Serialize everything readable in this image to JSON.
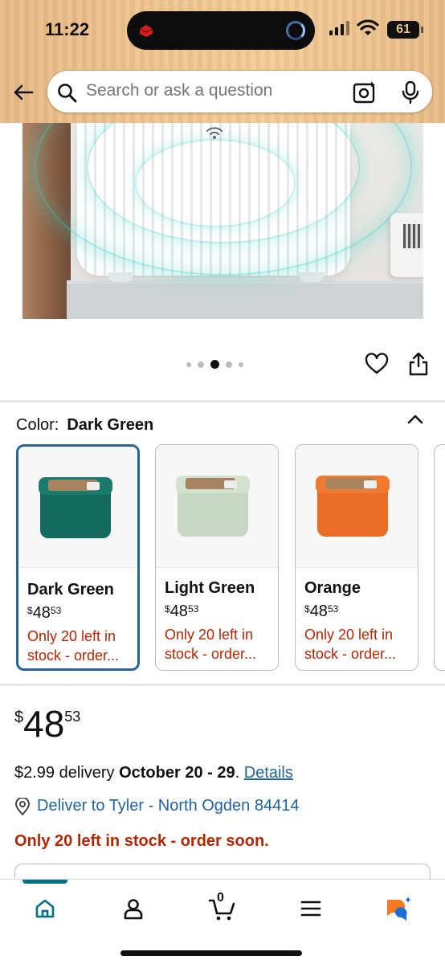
{
  "status_bar": {
    "time": "11:22",
    "battery": "61"
  },
  "search": {
    "placeholder": "Search or ask a question"
  },
  "carousel": {
    "total": 5,
    "active_index": 2
  },
  "color": {
    "label": "Color:",
    "selected": "Dark Green",
    "options": [
      {
        "name": "Dark Green",
        "price_whole": "48",
        "price_fraction": "53",
        "currency": "$",
        "stock": "Only 20 left in stock - order...",
        "body_color": "#136b5e",
        "lid_color": "#1a7a6c",
        "selected": true
      },
      {
        "name": "Light Green",
        "price_whole": "48",
        "price_fraction": "53",
        "currency": "$",
        "stock": "Only 20 left in stock - order...",
        "body_color": "#c7d8c2",
        "lid_color": "#d3e1cf",
        "selected": false
      },
      {
        "name": "Orange",
        "price_whole": "48",
        "price_fraction": "53",
        "currency": "$",
        "stock": "Only 20 left in stock - order...",
        "body_color": "#e96d24",
        "lid_color": "#f07a2f",
        "selected": false
      }
    ]
  },
  "price": {
    "currency": "$",
    "whole": "48",
    "fraction": "53"
  },
  "delivery": {
    "prefix": "$2.99 delivery ",
    "dates": "October 20 - 29",
    "suffix": ". ",
    "details_link": "Details"
  },
  "location": {
    "text": "Deliver to Tyler - North Ogden 84414"
  },
  "stock_message": "Only 20 left in stock - order soon.",
  "bottom_nav": {
    "cart_count": "0",
    "active": "home"
  },
  "colors": {
    "link": "#2162a1",
    "alert": "#b12704",
    "accent": "#007185",
    "selected_border": "#2a6496"
  }
}
